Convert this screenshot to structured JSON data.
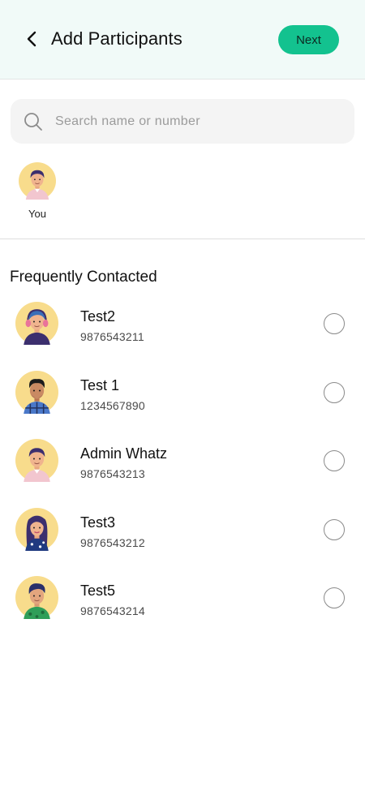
{
  "header": {
    "title": "Add Participants",
    "next_label": "Next",
    "background": "#f1faf8"
  },
  "search": {
    "placeholder": "Search name or number",
    "value": "",
    "icon": "search-icon"
  },
  "selected": [
    {
      "label": "You",
      "avatar": "avatar-man-pink-shirt"
    }
  ],
  "section": {
    "title": "Frequently Contacted"
  },
  "contacts": [
    {
      "name": "Test2",
      "phone": "9876543211",
      "avatar": "avatar-man-headphones",
      "selected": false
    },
    {
      "name": "Test 1",
      "phone": "1234567890",
      "avatar": "avatar-man-plaid-shirt",
      "selected": false
    },
    {
      "name": "Admin Whatz",
      "phone": "9876543213",
      "avatar": "avatar-man-pink-shirt",
      "selected": false
    },
    {
      "name": "Test3",
      "phone": "9876543212",
      "avatar": "avatar-woman-long-hair",
      "selected": false
    },
    {
      "name": "Test5",
      "phone": "9876543214",
      "avatar": "avatar-man-green-shirt",
      "selected": false
    }
  ],
  "colors": {
    "accent": "#13c28f",
    "avatar_bg": "#f8dc8c",
    "radio_border": "#8a8a8a"
  }
}
